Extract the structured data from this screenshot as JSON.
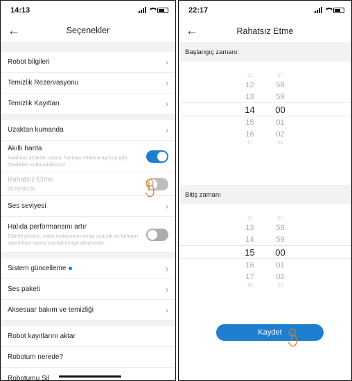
{
  "left": {
    "status": {
      "time": "14:13"
    },
    "title": "Seçenekler",
    "rows": {
      "robot_info": "Robot bilgileri",
      "cleaning_schedule": "Temizlik Rezervasyonu",
      "cleaning_records": "Temizlik Kayıtları",
      "remote_control": "Uzaktan kumanda",
      "smart_map": "Akıllı harita",
      "smart_map_desc": "Anahtarı açtıktan sonra, haritayı odalara ayırma gibi özellikleri kullanabilirsiniz",
      "dnd": "Rahatsız Etme",
      "dnd_time": "00:00-00:00",
      "volume": "Ses seviyesi",
      "carpet_boost": "Halıda performansını artır",
      "carpet_boost_desc": "Etkinleştirince, robot maksimum emişi açacak ve halıdan ayrıldıktan sonra normal emişe dönecektir.",
      "system_update": "Sistem güncelleme",
      "voice_pack": "Ses paketi",
      "accessory_care": "Aksesuar bakım ve temizliği",
      "export_logs": "Robot kayıtlarını aktar",
      "find_robot": "Robotum nerede?",
      "delete_robot": "Robotumu Sil"
    },
    "toggles": {
      "smart_map": true,
      "dnd": false,
      "carpet_boost": false
    },
    "colors": {
      "accent": "#1e7fd0"
    }
  },
  "right": {
    "status": {
      "time": "22:17"
    },
    "title": "Rahatsız Etme",
    "start_label": "Başlangıç zamanı:",
    "end_label": "Bitiş zamanı",
    "start_picker": {
      "hours": [
        "11",
        "12",
        "13",
        "14",
        "15",
        "16",
        "17"
      ],
      "minutes": [
        "57",
        "58",
        "59",
        "00",
        "01",
        "02",
        "03"
      ],
      "selected": {
        "hour": "14",
        "minute": "00"
      }
    },
    "end_picker": {
      "hours": [
        "12",
        "13",
        "14",
        "15",
        "16",
        "17",
        "18"
      ],
      "minutes": [
        "57",
        "58",
        "59",
        "00",
        "01",
        "02",
        "03"
      ],
      "selected": {
        "hour": "15",
        "minute": "00"
      }
    },
    "save_label": "Kaydet"
  }
}
